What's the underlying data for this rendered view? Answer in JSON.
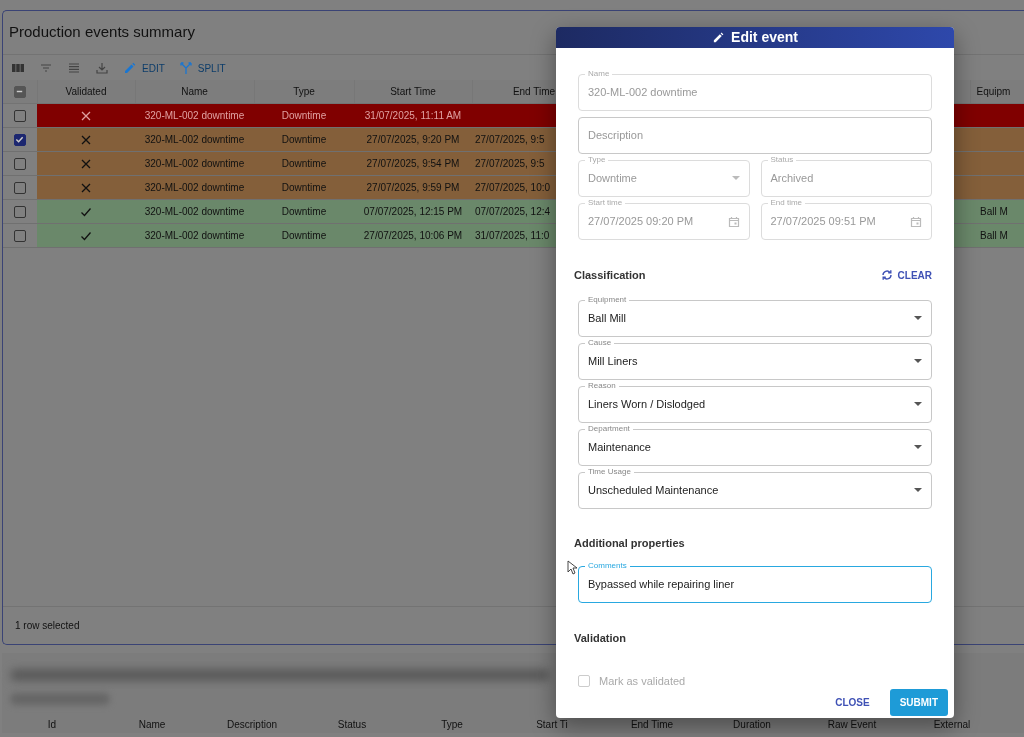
{
  "page": {
    "title": "Production events summary",
    "toolbar": [
      {
        "kind": "columns"
      },
      {
        "kind": "filter"
      },
      {
        "kind": "density"
      },
      {
        "kind": "export"
      },
      {
        "kind": "edit",
        "label": "EDIT"
      },
      {
        "kind": "split",
        "label": "SPLIT"
      }
    ],
    "table": {
      "select_all_indeterminate": true,
      "columns": [
        "Validated",
        "Name",
        "Type",
        "Start Time",
        "End Time",
        "Equipm"
      ],
      "rows": [
        {
          "selected": false,
          "validated": false,
          "color": "#800000",
          "name": "320-ML-002 downtime",
          "type": "Downtime",
          "start": "31/07/2025, 11:11 AM"
        },
        {
          "selected": true,
          "validated": false,
          "color": "#845f3a",
          "name": "320-ML-002 downtime",
          "type": "Downtime",
          "start": "27/07/2025, 9:20 PM",
          "end": "27/07/2025, 9:5"
        },
        {
          "selected": false,
          "validated": false,
          "color": "#845f3a",
          "name": "320-ML-002 downtime",
          "type": "Downtime",
          "start": "27/07/2025, 9:54 PM",
          "end": "27/07/2025, 9:5"
        },
        {
          "selected": false,
          "validated": false,
          "color": "#845f3a",
          "name": "320-ML-002 downtime",
          "type": "Downtime",
          "start": "27/07/2025, 9:59 PM",
          "end": "27/07/2025, 10:0"
        },
        {
          "selected": false,
          "validated": true,
          "color": "#6a886a",
          "name": "320-ML-002 downtime",
          "type": "Downtime",
          "start": "07/07/2025, 12:15 PM",
          "end": "07/07/2025, 12:4",
          "equipment": "Ball M"
        },
        {
          "selected": false,
          "validated": true,
          "color": "#6a886a",
          "name": "320-ML-002 downtime",
          "type": "Downtime",
          "start": "27/07/2025, 10:06 PM",
          "end": "31/07/2025, 11:0",
          "equipment": "Ball M"
        }
      ],
      "footer": "1 row selected"
    },
    "lower_table": {
      "columns": [
        "Id",
        "Name",
        "Description",
        "Status",
        "Type",
        "Start Ti",
        "End Time",
        "Duration",
        "Raw Event",
        "External"
      ]
    }
  },
  "dialog": {
    "title": "Edit event",
    "main_fields": [
      [
        {
          "kind": "text",
          "label": "Name",
          "value": "320-ML-002 downtime",
          "disabled": true,
          "focused": false
        }
      ],
      [
        {
          "kind": "text",
          "placeholder": "Description",
          "disabled": false,
          "focused": false
        }
      ],
      [
        {
          "kind": "select",
          "label": "Type",
          "value": "Downtime",
          "disabled": true,
          "focused": false
        },
        {
          "kind": "text",
          "label": "Status",
          "value": "Archived",
          "disabled": true,
          "focused": false
        }
      ],
      [
        {
          "kind": "date",
          "label": "Start time",
          "value": "27/07/2025 09:20 PM",
          "disabled": true,
          "focused": false
        },
        {
          "kind": "date",
          "label": "End time",
          "value": "27/07/2025 09:51 PM",
          "disabled": true,
          "focused": false
        }
      ]
    ],
    "classification": {
      "heading": "Classification",
      "clear_label": "CLEAR",
      "fields": [
        {
          "kind": "select",
          "label": "Equipment",
          "value": "Ball Mill",
          "disabled": false,
          "focused": false
        },
        {
          "kind": "select",
          "label": "Cause",
          "value": "Mill Liners",
          "disabled": false,
          "focused": false
        },
        {
          "kind": "select",
          "label": "Reason",
          "value": "Liners Worn / Dislodged",
          "disabled": false,
          "focused": false
        },
        {
          "kind": "select",
          "label": "Department",
          "value": "Maintenance",
          "disabled": false,
          "focused": false
        },
        {
          "kind": "select",
          "label": "Time Usage",
          "value": "Unscheduled Maintenance",
          "disabled": false,
          "focused": false
        }
      ]
    },
    "additional": {
      "heading": "Additional properties",
      "fields": [
        {
          "kind": "text",
          "label": "Comments",
          "value": "Bypassed while repairing liner",
          "disabled": false,
          "focused": true
        }
      ]
    },
    "validation": {
      "heading": "Validation",
      "checkbox": {
        "label": "Mark as validated",
        "checked": false,
        "disabled": true
      }
    },
    "buttons": [
      {
        "kind": "text",
        "label": "CLOSE"
      },
      {
        "kind": "primary",
        "label": "SUBMIT"
      }
    ]
  }
}
